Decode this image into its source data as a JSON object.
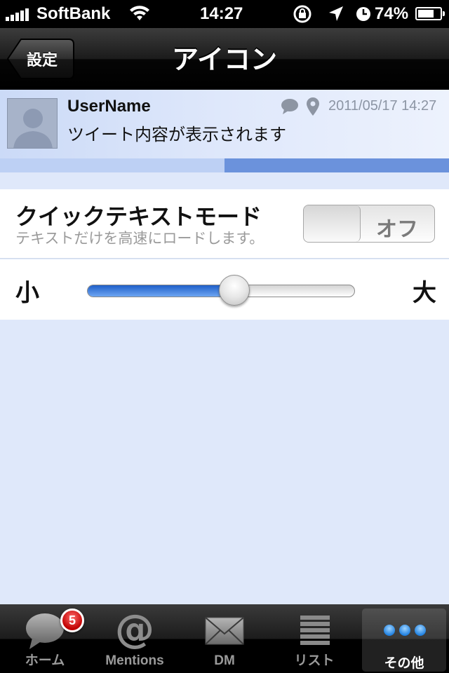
{
  "status_bar": {
    "carrier": "SoftBank",
    "time": "14:27",
    "battery_percent": "74%",
    "battery_level": 0.74,
    "icons": [
      "signal-bars-icon",
      "wifi-icon",
      "rotation-lock-icon",
      "location-arrow-icon",
      "alarm-clock-icon",
      "battery-icon"
    ]
  },
  "nav": {
    "back_label": "設定",
    "title": "アイコン"
  },
  "preview": {
    "username": "UserName",
    "tweet_text": "ツイート内容が表示されます",
    "date": "2011/05/17 14:27",
    "icons": [
      "reply-bubble-icon",
      "location-pin-icon"
    ],
    "progress": 0.5,
    "colors": {
      "progress_fill": "#6b92dc",
      "progress_track": "#bdd0f4"
    }
  },
  "settings": {
    "quick_text_mode": {
      "title": "クイックテキストモード",
      "subtitle": "テキストだけを高速にロードします。",
      "toggle_label": "オフ",
      "enabled": false
    },
    "icon_size": {
      "min_label": "小",
      "max_label": "大",
      "value": 0.55
    }
  },
  "tabbar": {
    "tabs": [
      {
        "label": "ホーム",
        "icon": "speech-bubble-icon",
        "badge": "5",
        "selected": false
      },
      {
        "label": "Mentions",
        "icon": "at-sign-icon",
        "selected": false
      },
      {
        "label": "DM",
        "icon": "envelope-icon",
        "selected": false
      },
      {
        "label": "リスト",
        "icon": "list-icon",
        "selected": false
      },
      {
        "label": "その他",
        "icon": "more-dots-icon",
        "selected": true
      }
    ]
  }
}
